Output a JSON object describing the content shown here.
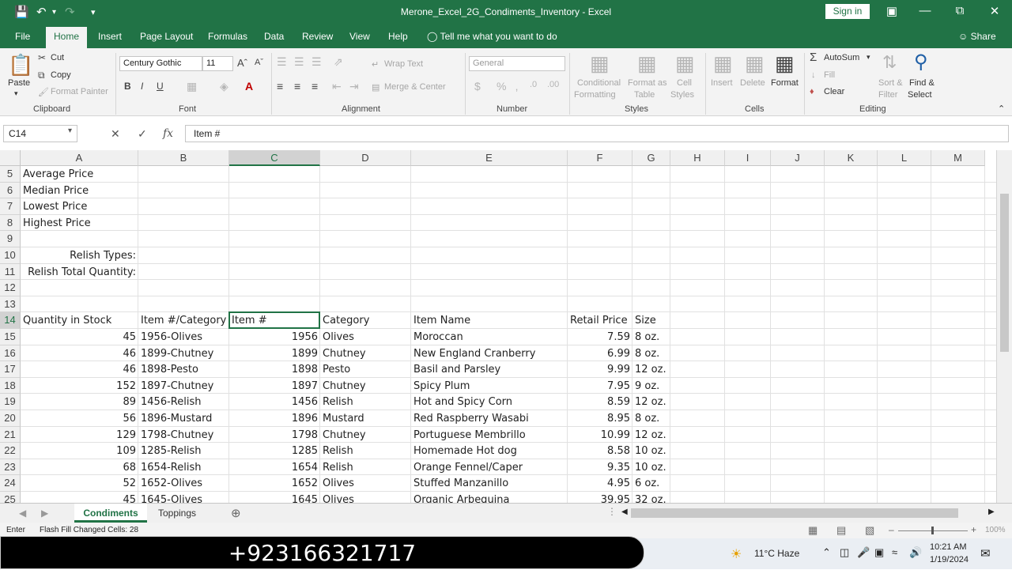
{
  "window": {
    "title": "Merone_Excel_2G_Condiments_Inventory  -  Excel",
    "sign_in": "Sign in"
  },
  "tabs": [
    "File",
    "Home",
    "Insert",
    "Page Layout",
    "Formulas",
    "Data",
    "Review",
    "View",
    "Help"
  ],
  "tell_me": "Tell me what you want to do",
  "share": "Share",
  "ribbon": {
    "clipboard": {
      "paste": "Paste",
      "cut": "Cut",
      "copy": "Copy",
      "format_painter": "Format Painter",
      "group": "Clipboard"
    },
    "font": {
      "name": "Century Gothic",
      "size": "11",
      "group": "Font"
    },
    "alignment": {
      "wrap_text": "Wrap Text",
      "merge_center": "Merge & Center",
      "group": "Alignment"
    },
    "number": {
      "format": "General",
      "group": "Number"
    },
    "styles": {
      "conditional": "Conditional",
      "formatting": "Formatting",
      "format_as": "Format as",
      "table": "Table",
      "cell": "Cell",
      "styles_label": "Styles",
      "group": "Styles"
    },
    "cells": {
      "insert": "Insert",
      "delete": "Delete",
      "format": "Format",
      "group": "Cells"
    },
    "editing": {
      "autosum": "AutoSum",
      "fill": "Fill",
      "clear": "Clear",
      "sort": "Sort &",
      "filter": "Filter",
      "find": "Find &",
      "select": "Select",
      "group": "Editing"
    }
  },
  "formula_bar": {
    "name_box": "C14",
    "formula": "Item #"
  },
  "columns": [
    "A",
    "B",
    "C",
    "D",
    "E",
    "F",
    "G",
    "H",
    "I",
    "J",
    "K",
    "L",
    "M"
  ],
  "rows": [
    {
      "n": "5",
      "a": "Average Price"
    },
    {
      "n": "6",
      "a": "Median Price"
    },
    {
      "n": "7",
      "a": "Lowest Price"
    },
    {
      "n": "8",
      "a": "Highest Price"
    },
    {
      "n": "9"
    },
    {
      "n": "10",
      "a": "Relish Types:"
    },
    {
      "n": "11",
      "a": "Relish Total Quantity:"
    },
    {
      "n": "12"
    },
    {
      "n": "13"
    },
    {
      "n": "14",
      "a": "Quantity in Stock",
      "b": "Item #/Category",
      "c": "Item #",
      "d": "Category",
      "e": "Item Name",
      "f": "Retail Price",
      "g": "Size"
    },
    {
      "n": "15",
      "a": "45",
      "b": "1956-Olives",
      "c": "1956",
      "d": "Olives",
      "e": "Moroccan",
      "f": "7.59",
      "g": "8 oz."
    },
    {
      "n": "16",
      "a": "46",
      "b": "1899-Chutney",
      "c": "1899",
      "d": "Chutney",
      "e": "New England Cranberry",
      "f": "6.99",
      "g": "8 oz."
    },
    {
      "n": "17",
      "a": "46",
      "b": "1898-Pesto",
      "c": "1898",
      "d": "Pesto",
      "e": "Basil and Parsley",
      "f": "9.99",
      "g": "12 oz."
    },
    {
      "n": "18",
      "a": "152",
      "b": "1897-Chutney",
      "c": "1897",
      "d": "Chutney",
      "e": "Spicy Plum",
      "f": "7.95",
      "g": "9 oz."
    },
    {
      "n": "19",
      "a": "89",
      "b": "1456-Relish",
      "c": "1456",
      "d": "Relish",
      "e": "Hot and Spicy Corn",
      "f": "8.59",
      "g": "12 oz."
    },
    {
      "n": "20",
      "a": "56",
      "b": "1896-Mustard",
      "c": "1896",
      "d": "Mustard",
      "e": "Red Raspberry Wasabi",
      "f": "8.95",
      "g": "8 oz."
    },
    {
      "n": "21",
      "a": "129",
      "b": "1798-Chutney",
      "c": "1798",
      "d": "Chutney",
      "e": "Portuguese Membrillo",
      "f": "10.99",
      "g": "12 oz."
    },
    {
      "n": "22",
      "a": "109",
      "b": "1285-Relish",
      "c": "1285",
      "d": "Relish",
      "e": "Homemade Hot dog",
      "f": "8.58",
      "g": "10 oz."
    },
    {
      "n": "23",
      "a": "68",
      "b": "1654-Relish",
      "c": "1654",
      "d": "Relish",
      "e": "Orange Fennel/Caper",
      "f": "9.35",
      "g": "10 oz."
    },
    {
      "n": "24",
      "a": "52",
      "b": "1652-Olives",
      "c": "1652",
      "d": "Olives",
      "e": "Stuffed Manzanillo",
      "f": "4.95",
      "g": "6 oz."
    },
    {
      "n": "25",
      "a": "45",
      "b": "1645-Olives",
      "c": "1645",
      "d": "Olives",
      "e": "Organic Arbequina",
      "f": "39.95",
      "g": "32 oz."
    }
  ],
  "sheets": [
    "Condiments",
    "Toppings"
  ],
  "status": {
    "mode": "Enter",
    "message": "Flash Fill Changed Cells: 28",
    "zoom": "100%"
  },
  "taskbar": {
    "phone": "+923166321717",
    "weather": "11°C  Haze",
    "time": "10:21 AM",
    "date": "1/19/2024"
  }
}
